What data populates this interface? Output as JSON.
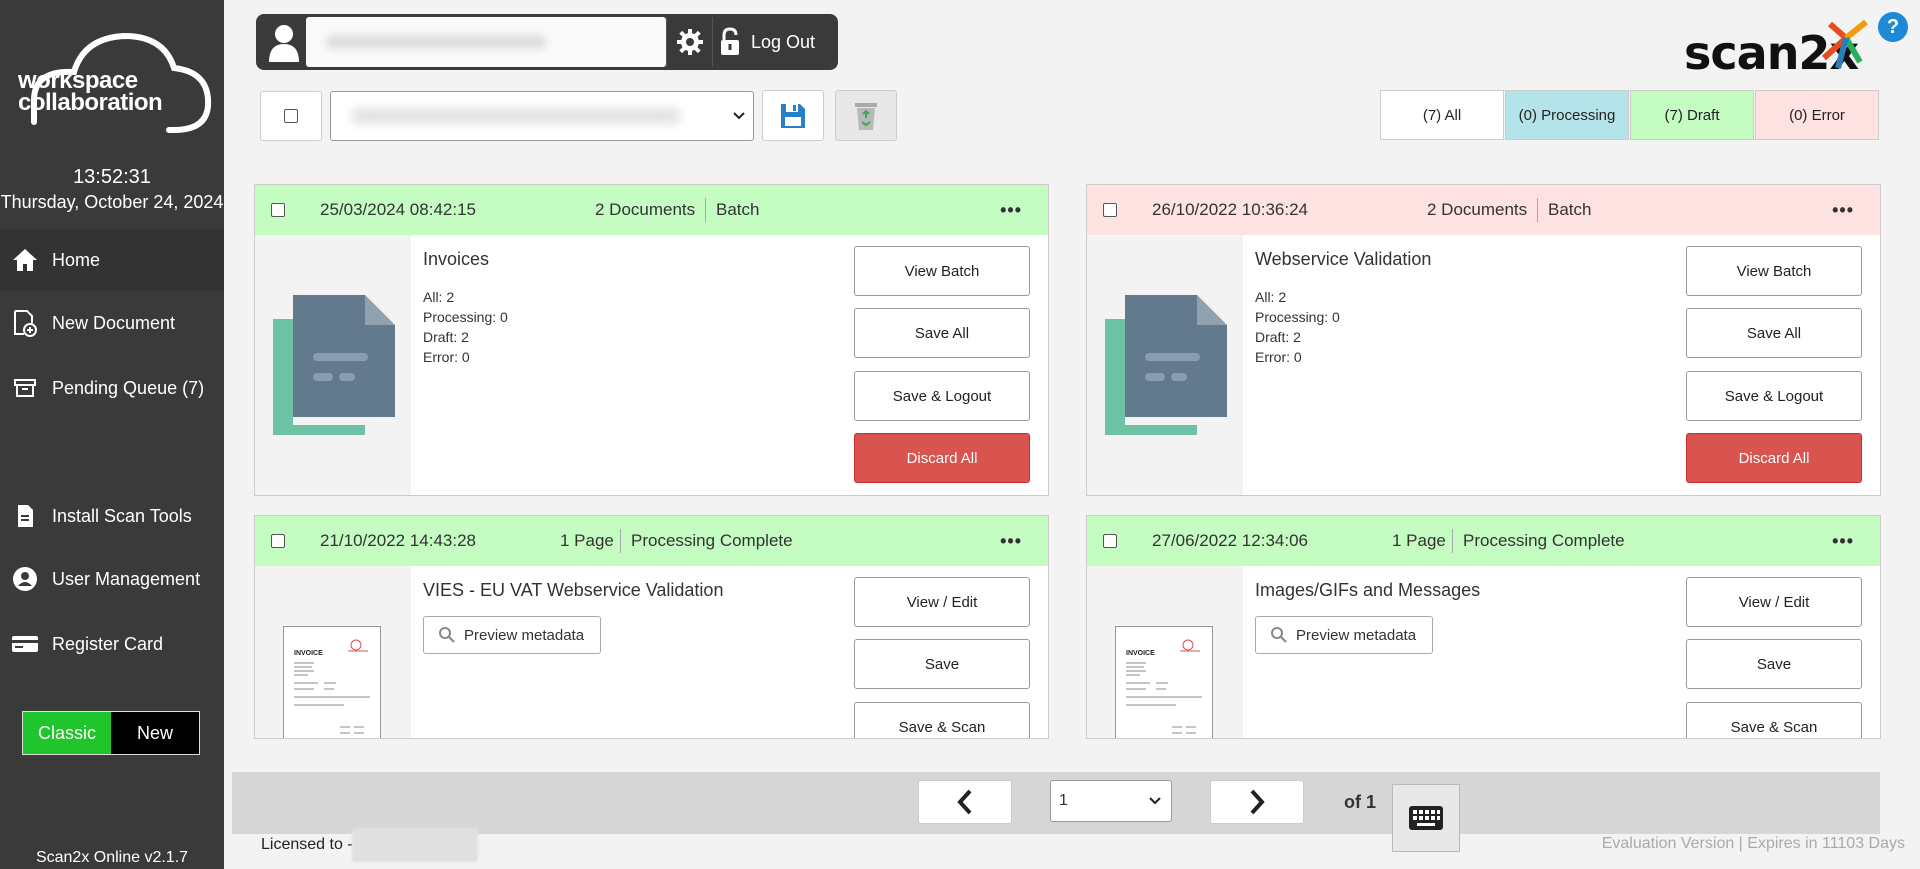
{
  "sidebar": {
    "logo_line1": "workspace",
    "logo_line2": "collaboration",
    "time": "13:52:31",
    "date": "Thursday, October 24, 2024",
    "items": [
      {
        "label": "Home",
        "icon": "home-icon"
      },
      {
        "label": "New Document",
        "icon": "new-document-icon"
      },
      {
        "label": "Pending Queue (7)",
        "icon": "archive-icon"
      },
      {
        "label": "Install Scan Tools",
        "icon": "file-icon"
      },
      {
        "label": "User Management",
        "icon": "user-circle-icon"
      },
      {
        "label": "Register Card",
        "icon": "card-icon"
      }
    ],
    "toggle_classic": "Classic",
    "toggle_new": "New",
    "version": "Scan2x Online v2.1.7"
  },
  "header": {
    "logout_label": "Log Out",
    "brand": "scan2x",
    "help": "?"
  },
  "filters": {
    "all": "(7) All",
    "processing": "(0) Processing",
    "draft": "(7) Draft",
    "error": "(0) Error",
    "colors": {
      "all": "#ffffff",
      "processing": "#b5e3ea",
      "draft": "#c4fcc2",
      "error": "#fde2e1"
    }
  },
  "cards": [
    {
      "date": "25/03/2024 08:42:15",
      "count": "2 Documents",
      "kind": "Batch",
      "title": "Invoices",
      "stats": [
        "All: 2",
        "Processing: 0",
        "Draft: 2",
        "Error: 0"
      ],
      "buttons": [
        "View Batch",
        "Save All",
        "Save & Logout",
        "Discard All"
      ]
    },
    {
      "date": "26/10/2022 10:36:24",
      "count": "2 Documents",
      "kind": "Batch",
      "title": "Webservice Validation",
      "stats": [
        "All: 2",
        "Processing: 0",
        "Draft: 2",
        "Error: 0"
      ],
      "buttons": [
        "View Batch",
        "Save All",
        "Save & Logout",
        "Discard All"
      ]
    },
    {
      "date": "21/10/2022 14:43:28",
      "count": "1 Page",
      "kind": "Processing Complete",
      "title": "VIES - EU VAT Webservice Validation",
      "preview": "Preview metadata",
      "buttons": [
        "View / Edit",
        "Save",
        "Save & Scan"
      ]
    },
    {
      "date": "27/06/2022 12:34:06",
      "count": "1 Page",
      "kind": "Processing Complete",
      "title": "Images/GIFs and Messages",
      "preview": "Preview metadata",
      "buttons": [
        "View / Edit",
        "Save",
        "Save & Scan"
      ]
    }
  ],
  "pager": {
    "page": "1",
    "of": "of 1"
  },
  "footer": {
    "licensed": "Licensed to -",
    "eval": "Evaluation Version | Expires in 11103 Days"
  }
}
